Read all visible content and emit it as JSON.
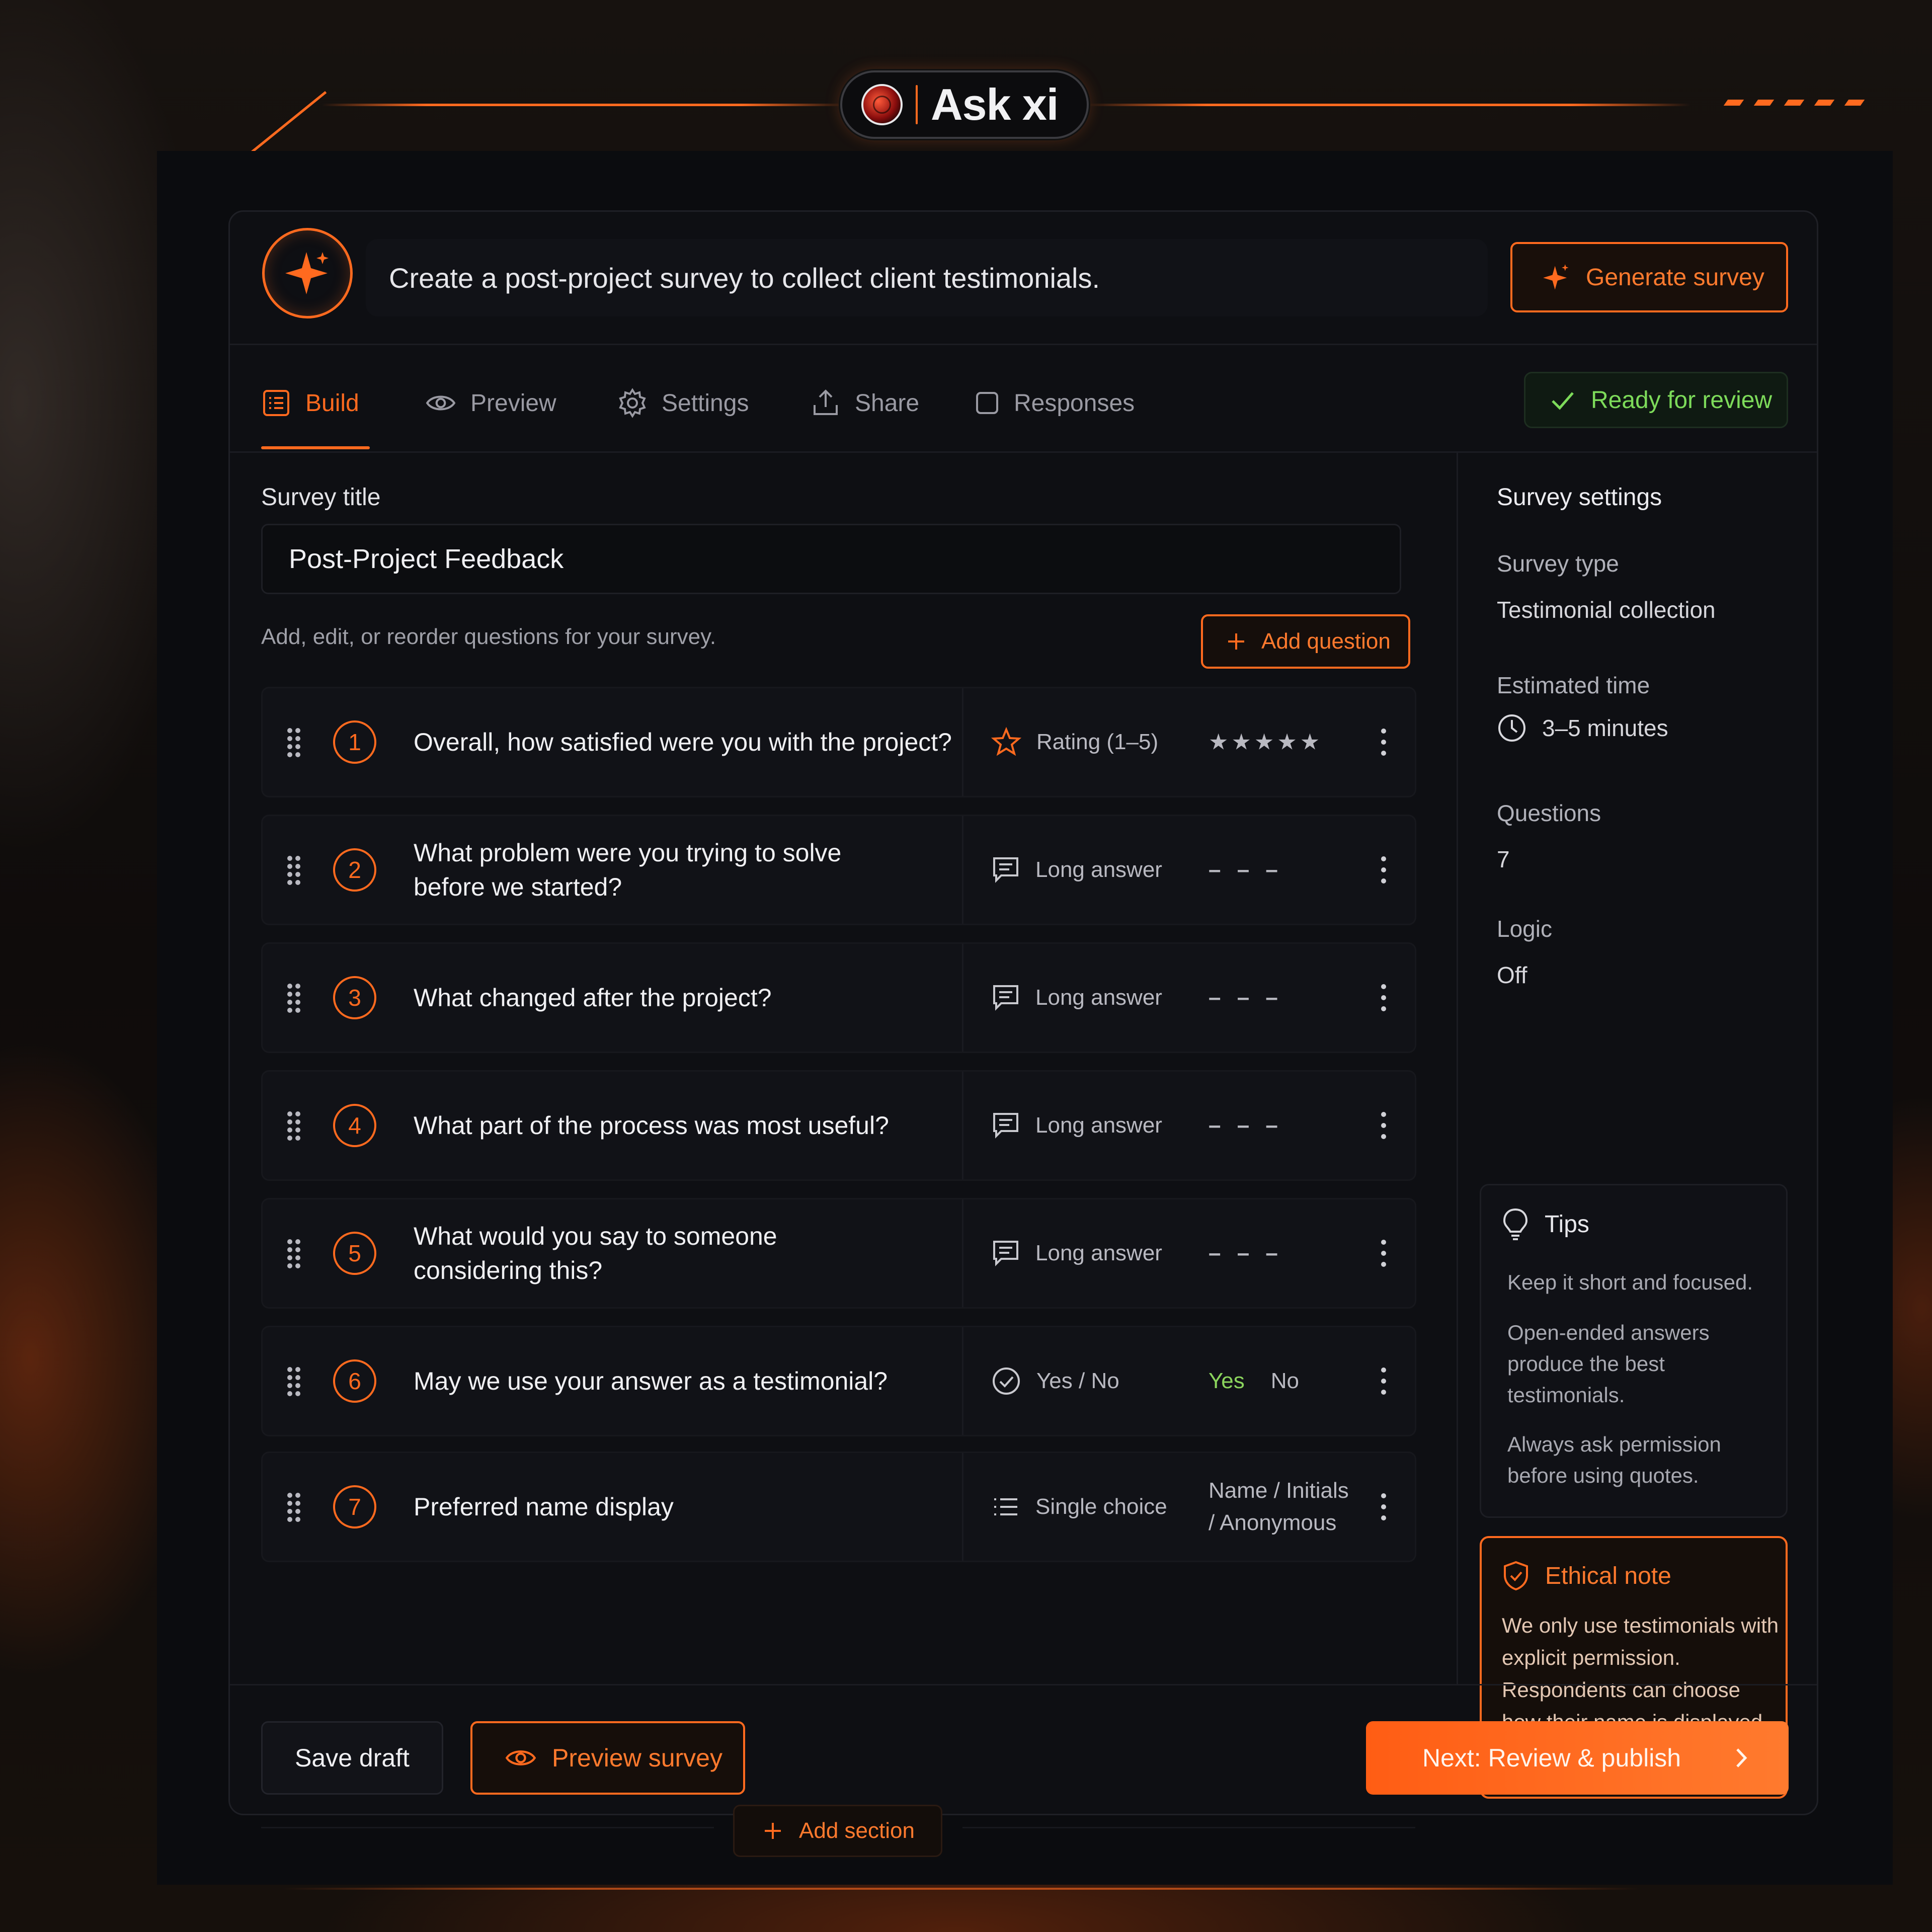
{
  "brand": {
    "name": "Ask xi"
  },
  "prompt": {
    "text": "Create a post-project survey to collect client testimonials.",
    "generate_label": "Generate survey"
  },
  "tabs": [
    {
      "label": "Build",
      "icon": "list-icon",
      "active": true
    },
    {
      "label": "Preview",
      "icon": "eye-icon"
    },
    {
      "label": "Settings",
      "icon": "gear-icon"
    },
    {
      "label": "Share",
      "icon": "upload-icon"
    },
    {
      "label": "Responses",
      "icon": "square-icon"
    }
  ],
  "status": {
    "label": "Ready for review",
    "color": "#7ddb5a"
  },
  "builder": {
    "title_label": "Survey title",
    "title_value": "Post-Project Feedback",
    "hint": "Add, edit, or reorder questions for your survey.",
    "add_question_label": "Add question",
    "add_section_label": "Add section"
  },
  "questions": [
    {
      "num": "1",
      "text": "Overall, how satisfied were you with the project?",
      "type": "Rating (1–5)",
      "type_icon": "star-icon",
      "preview": "★★★★★"
    },
    {
      "num": "2",
      "text": "What problem were you trying to solve before we started?",
      "type": "Long answer",
      "type_icon": "textbox-icon",
      "preview": "– – –"
    },
    {
      "num": "3",
      "text": "What changed after the project?",
      "type": "Long answer",
      "type_icon": "textbox-icon",
      "preview": "– – –"
    },
    {
      "num": "4",
      "text": "What part of the process was most useful?",
      "type": "Long answer",
      "type_icon": "textbox-icon",
      "preview": "– – –"
    },
    {
      "num": "5",
      "text": "What would you say to someone considering this?",
      "type": "Long answer",
      "type_icon": "textbox-icon",
      "preview": "– – –"
    },
    {
      "num": "6",
      "text": "May we use your answer as a testimonial?",
      "type": "Yes / No",
      "type_icon": "check-circle-icon",
      "preview_yes": "Yes",
      "preview_no": "No"
    },
    {
      "num": "7",
      "text": "Preferred name display",
      "type": "Single choice",
      "type_icon": "list-bullets-icon",
      "preview": "Name / Initials / Anonymous"
    }
  ],
  "settings": {
    "heading": "Survey settings",
    "type_label": "Survey type",
    "type_value": "Testimonial collection",
    "time_label": "Estimated time",
    "time_value": "3–5 minutes",
    "questions_label": "Questions",
    "questions_value": "7",
    "logic_label": "Logic",
    "logic_value": "Off"
  },
  "tips": {
    "heading": "Tips",
    "items": [
      "Keep it short and focused.",
      "Open-ended answers produce the best testimonials.",
      "Always ask permission before using quotes."
    ]
  },
  "ethical": {
    "heading": "Ethical note",
    "text": "We only use testimonials with explicit permission. Respondents can choose how their name is displayed or remain anonymous."
  },
  "footer": {
    "save_label": "Save draft",
    "preview_label": "Preview survey",
    "next_label": "Next: Review & publish"
  },
  "colors": {
    "accent": "#ff6a1f",
    "background": "#0e0f13"
  }
}
